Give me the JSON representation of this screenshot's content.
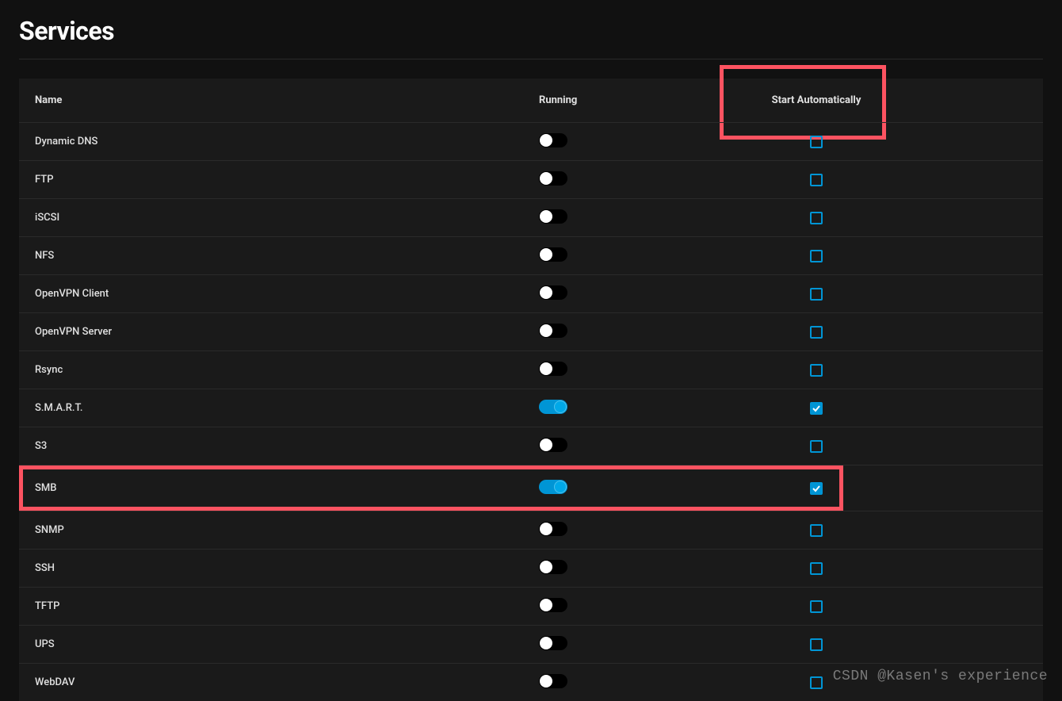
{
  "page": {
    "title": "Services"
  },
  "columns": {
    "name": "Name",
    "running": "Running",
    "start_auto": "Start Automatically"
  },
  "services": [
    {
      "name": "Dynamic DNS",
      "running": false,
      "start_auto": false,
      "highlighted": false
    },
    {
      "name": "FTP",
      "running": false,
      "start_auto": false,
      "highlighted": false
    },
    {
      "name": "iSCSI",
      "running": false,
      "start_auto": false,
      "highlighted": false
    },
    {
      "name": "NFS",
      "running": false,
      "start_auto": false,
      "highlighted": false
    },
    {
      "name": "OpenVPN Client",
      "running": false,
      "start_auto": false,
      "highlighted": false
    },
    {
      "name": "OpenVPN Server",
      "running": false,
      "start_auto": false,
      "highlighted": false
    },
    {
      "name": "Rsync",
      "running": false,
      "start_auto": false,
      "highlighted": false
    },
    {
      "name": "S.M.A.R.T.",
      "running": true,
      "start_auto": true,
      "highlighted": false
    },
    {
      "name": "S3",
      "running": false,
      "start_auto": false,
      "highlighted": false
    },
    {
      "name": "SMB",
      "running": true,
      "start_auto": true,
      "highlighted": true
    },
    {
      "name": "SNMP",
      "running": false,
      "start_auto": false,
      "highlighted": false
    },
    {
      "name": "SSH",
      "running": false,
      "start_auto": false,
      "highlighted": false
    },
    {
      "name": "TFTP",
      "running": false,
      "start_auto": false,
      "highlighted": false
    },
    {
      "name": "UPS",
      "running": false,
      "start_auto": false,
      "highlighted": false
    },
    {
      "name": "WebDAV",
      "running": false,
      "start_auto": false,
      "highlighted": false
    }
  ],
  "watermark": "CSDN @Kasen's experience",
  "highlight_color": "#fd5361",
  "accent_color": "#0095d5"
}
